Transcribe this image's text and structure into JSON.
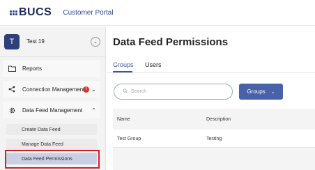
{
  "header": {
    "logo_text": "BUCS",
    "portal_title": "Customer Portal"
  },
  "user": {
    "initial": "T",
    "name": "Test 19"
  },
  "sidebar": {
    "items": [
      {
        "label": "Reports"
      },
      {
        "label": "Connection Management",
        "alert": "!"
      },
      {
        "label": "Data Feed Management"
      }
    ],
    "subitems": [
      {
        "label": "Create Data Feed"
      },
      {
        "label": "Manage Data Feed"
      },
      {
        "label": "Data Feed Permissions"
      }
    ]
  },
  "main": {
    "title": "Data Feed Permissions",
    "tabs": [
      {
        "label": "Groups"
      },
      {
        "label": "Users"
      }
    ],
    "search": {
      "placeholder": "Search"
    },
    "groups_button": "Groups",
    "table": {
      "headers": [
        "Name",
        "Description"
      ],
      "rows": [
        {
          "name": "Test Group",
          "description": "Testing"
        }
      ]
    }
  },
  "colors": {
    "accent": "#4961a6",
    "highlight": "#d21f1f",
    "alert": "#d9342b"
  }
}
